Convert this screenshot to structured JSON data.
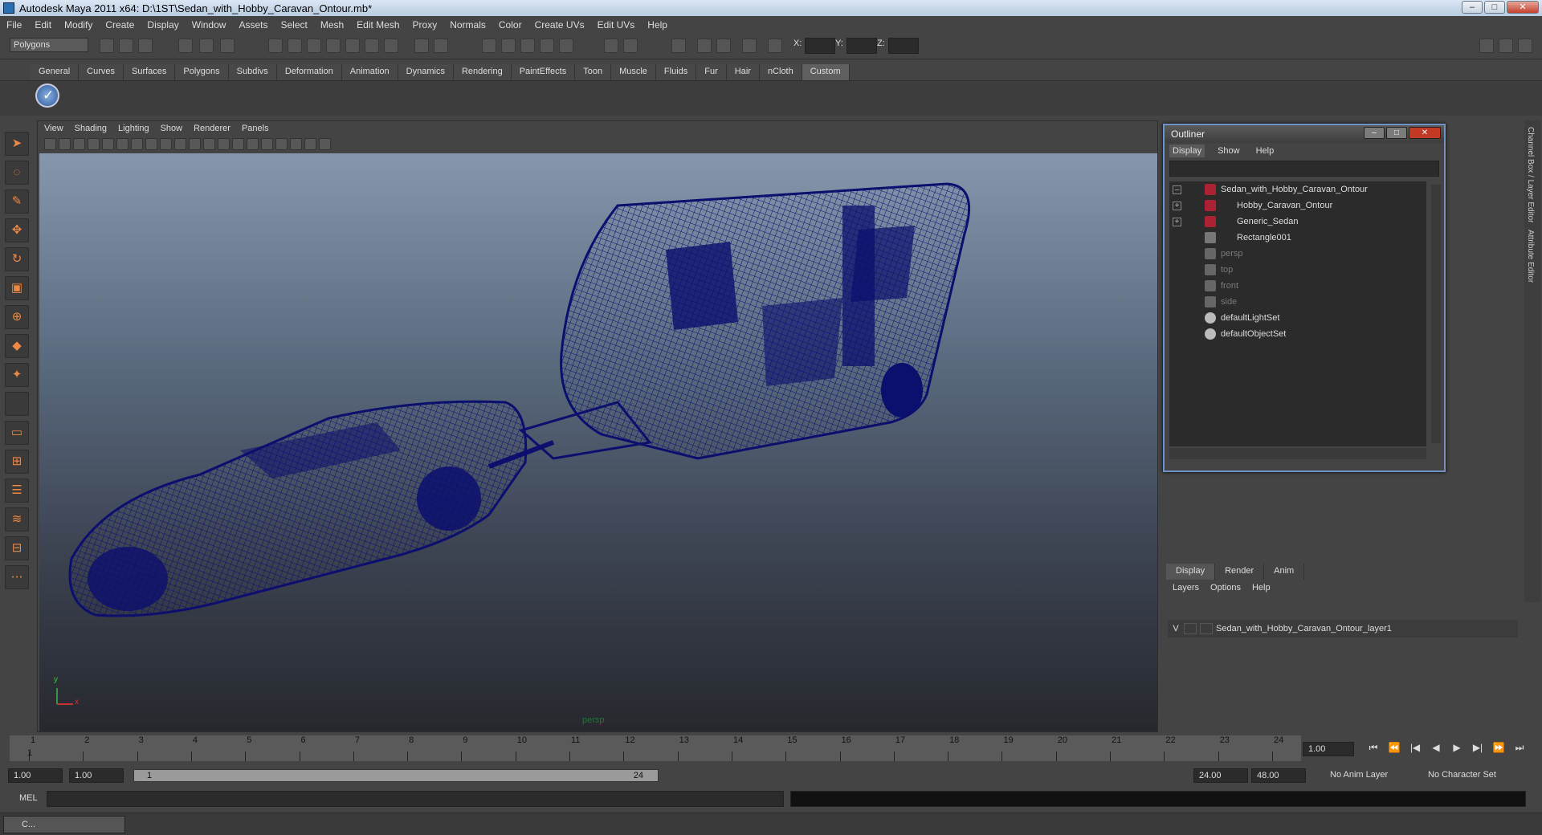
{
  "window": {
    "title": "Autodesk Maya 2011 x64: D:\\1ST\\Sedan_with_Hobby_Caravan_Ontour.mb*",
    "min_label": "–",
    "max_label": "□",
    "close_label": "✕"
  },
  "menus": [
    "File",
    "Edit",
    "Modify",
    "Create",
    "Display",
    "Window",
    "Assets",
    "Select",
    "Mesh",
    "Edit Mesh",
    "Proxy",
    "Normals",
    "Color",
    "Create UVs",
    "Edit UVs",
    "Help"
  ],
  "status": {
    "mode": "Polygons",
    "x_label": "X:",
    "y_label": "Y:",
    "z_label": "Z:"
  },
  "shelf_tabs": [
    "General",
    "Curves",
    "Surfaces",
    "Polygons",
    "Subdivs",
    "Deformation",
    "Animation",
    "Dynamics",
    "Rendering",
    "PaintEffects",
    "Toon",
    "Muscle",
    "Fluids",
    "Fur",
    "Hair",
    "nCloth",
    "Custom"
  ],
  "active_shelf": "Custom",
  "panel": {
    "menus": [
      "View",
      "Shading",
      "Lighting",
      "Show",
      "Renderer",
      "Panels"
    ],
    "camera": "persp",
    "axis_y": "y",
    "axis_x": "x"
  },
  "outliner": {
    "title": "Outliner",
    "menus": [
      "Display",
      "Show",
      "Help"
    ],
    "items": [
      {
        "label": "Sedan_with_Hobby_Caravan_Ontour",
        "expander": "–",
        "dim": false
      },
      {
        "label": "Hobby_Caravan_Ontour",
        "expander": "+",
        "dim": false
      },
      {
        "label": "Generic_Sedan",
        "expander": "+",
        "dim": false
      },
      {
        "label": "Rectangle001",
        "expander": "",
        "dim": false
      },
      {
        "label": "persp",
        "expander": "",
        "dim": true
      },
      {
        "label": "top",
        "expander": "",
        "dim": true
      },
      {
        "label": "front",
        "expander": "",
        "dim": true
      },
      {
        "label": "side",
        "expander": "",
        "dim": true
      },
      {
        "label": "defaultLightSet",
        "expander": "",
        "dim": false
      },
      {
        "label": "defaultObjectSet",
        "expander": "",
        "dim": false
      }
    ]
  },
  "side_tabs": [
    "Channel Box / Layer Editor",
    "Attribute Editor"
  ],
  "layers": {
    "tabs": [
      "Display",
      "Render",
      "Anim"
    ],
    "menus": [
      "Layers",
      "Options",
      "Help"
    ],
    "row": {
      "visible": "V",
      "name": "Sedan_with_Hobby_Caravan_Ontour_layer1"
    }
  },
  "timeline": {
    "ticks": [
      "1",
      "2",
      "3",
      "4",
      "5",
      "6",
      "7",
      "8",
      "9",
      "10",
      "11",
      "12",
      "13",
      "14",
      "15",
      "16",
      "17",
      "18",
      "19",
      "20",
      "21",
      "22",
      "23",
      "24"
    ],
    "current_frame": "1.00",
    "marker": "1"
  },
  "range": {
    "start": "1.00",
    "start2": "1.00",
    "slider_start": "1",
    "slider_end": "24",
    "end": "24.00",
    "end2": "48.00",
    "anim_layer": "No Anim Layer",
    "char_set": "No Character Set"
  },
  "command": {
    "label": "MEL"
  },
  "taskbar": {
    "label": "C..."
  },
  "colors": {
    "wireframe": "#0c0f6e",
    "viewport_top": "#8697ad",
    "viewport_bottom": "#26282d",
    "outliner_border": "#6e93c4"
  }
}
